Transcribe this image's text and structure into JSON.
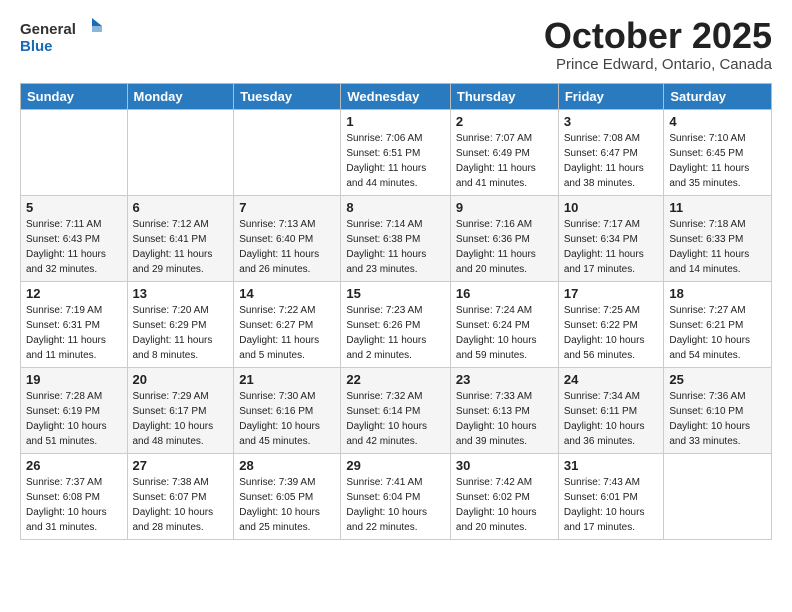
{
  "header": {
    "logo_general": "General",
    "logo_blue": "Blue",
    "month": "October 2025",
    "location": "Prince Edward, Ontario, Canada"
  },
  "days_of_week": [
    "Sunday",
    "Monday",
    "Tuesday",
    "Wednesday",
    "Thursday",
    "Friday",
    "Saturday"
  ],
  "weeks": [
    [
      {
        "day": "",
        "info": ""
      },
      {
        "day": "",
        "info": ""
      },
      {
        "day": "",
        "info": ""
      },
      {
        "day": "1",
        "info": "Sunrise: 7:06 AM\nSunset: 6:51 PM\nDaylight: 11 hours\nand 44 minutes."
      },
      {
        "day": "2",
        "info": "Sunrise: 7:07 AM\nSunset: 6:49 PM\nDaylight: 11 hours\nand 41 minutes."
      },
      {
        "day": "3",
        "info": "Sunrise: 7:08 AM\nSunset: 6:47 PM\nDaylight: 11 hours\nand 38 minutes."
      },
      {
        "day": "4",
        "info": "Sunrise: 7:10 AM\nSunset: 6:45 PM\nDaylight: 11 hours\nand 35 minutes."
      }
    ],
    [
      {
        "day": "5",
        "info": "Sunrise: 7:11 AM\nSunset: 6:43 PM\nDaylight: 11 hours\nand 32 minutes."
      },
      {
        "day": "6",
        "info": "Sunrise: 7:12 AM\nSunset: 6:41 PM\nDaylight: 11 hours\nand 29 minutes."
      },
      {
        "day": "7",
        "info": "Sunrise: 7:13 AM\nSunset: 6:40 PM\nDaylight: 11 hours\nand 26 minutes."
      },
      {
        "day": "8",
        "info": "Sunrise: 7:14 AM\nSunset: 6:38 PM\nDaylight: 11 hours\nand 23 minutes."
      },
      {
        "day": "9",
        "info": "Sunrise: 7:16 AM\nSunset: 6:36 PM\nDaylight: 11 hours\nand 20 minutes."
      },
      {
        "day": "10",
        "info": "Sunrise: 7:17 AM\nSunset: 6:34 PM\nDaylight: 11 hours\nand 17 minutes."
      },
      {
        "day": "11",
        "info": "Sunrise: 7:18 AM\nSunset: 6:33 PM\nDaylight: 11 hours\nand 14 minutes."
      }
    ],
    [
      {
        "day": "12",
        "info": "Sunrise: 7:19 AM\nSunset: 6:31 PM\nDaylight: 11 hours\nand 11 minutes."
      },
      {
        "day": "13",
        "info": "Sunrise: 7:20 AM\nSunset: 6:29 PM\nDaylight: 11 hours\nand 8 minutes."
      },
      {
        "day": "14",
        "info": "Sunrise: 7:22 AM\nSunset: 6:27 PM\nDaylight: 11 hours\nand 5 minutes."
      },
      {
        "day": "15",
        "info": "Sunrise: 7:23 AM\nSunset: 6:26 PM\nDaylight: 11 hours\nand 2 minutes."
      },
      {
        "day": "16",
        "info": "Sunrise: 7:24 AM\nSunset: 6:24 PM\nDaylight: 10 hours\nand 59 minutes."
      },
      {
        "day": "17",
        "info": "Sunrise: 7:25 AM\nSunset: 6:22 PM\nDaylight: 10 hours\nand 56 minutes."
      },
      {
        "day": "18",
        "info": "Sunrise: 7:27 AM\nSunset: 6:21 PM\nDaylight: 10 hours\nand 54 minutes."
      }
    ],
    [
      {
        "day": "19",
        "info": "Sunrise: 7:28 AM\nSunset: 6:19 PM\nDaylight: 10 hours\nand 51 minutes."
      },
      {
        "day": "20",
        "info": "Sunrise: 7:29 AM\nSunset: 6:17 PM\nDaylight: 10 hours\nand 48 minutes."
      },
      {
        "day": "21",
        "info": "Sunrise: 7:30 AM\nSunset: 6:16 PM\nDaylight: 10 hours\nand 45 minutes."
      },
      {
        "day": "22",
        "info": "Sunrise: 7:32 AM\nSunset: 6:14 PM\nDaylight: 10 hours\nand 42 minutes."
      },
      {
        "day": "23",
        "info": "Sunrise: 7:33 AM\nSunset: 6:13 PM\nDaylight: 10 hours\nand 39 minutes."
      },
      {
        "day": "24",
        "info": "Sunrise: 7:34 AM\nSunset: 6:11 PM\nDaylight: 10 hours\nand 36 minutes."
      },
      {
        "day": "25",
        "info": "Sunrise: 7:36 AM\nSunset: 6:10 PM\nDaylight: 10 hours\nand 33 minutes."
      }
    ],
    [
      {
        "day": "26",
        "info": "Sunrise: 7:37 AM\nSunset: 6:08 PM\nDaylight: 10 hours\nand 31 minutes."
      },
      {
        "day": "27",
        "info": "Sunrise: 7:38 AM\nSunset: 6:07 PM\nDaylight: 10 hours\nand 28 minutes."
      },
      {
        "day": "28",
        "info": "Sunrise: 7:39 AM\nSunset: 6:05 PM\nDaylight: 10 hours\nand 25 minutes."
      },
      {
        "day": "29",
        "info": "Sunrise: 7:41 AM\nSunset: 6:04 PM\nDaylight: 10 hours\nand 22 minutes."
      },
      {
        "day": "30",
        "info": "Sunrise: 7:42 AM\nSunset: 6:02 PM\nDaylight: 10 hours\nand 20 minutes."
      },
      {
        "day": "31",
        "info": "Sunrise: 7:43 AM\nSunset: 6:01 PM\nDaylight: 10 hours\nand 17 minutes."
      },
      {
        "day": "",
        "info": ""
      }
    ]
  ]
}
